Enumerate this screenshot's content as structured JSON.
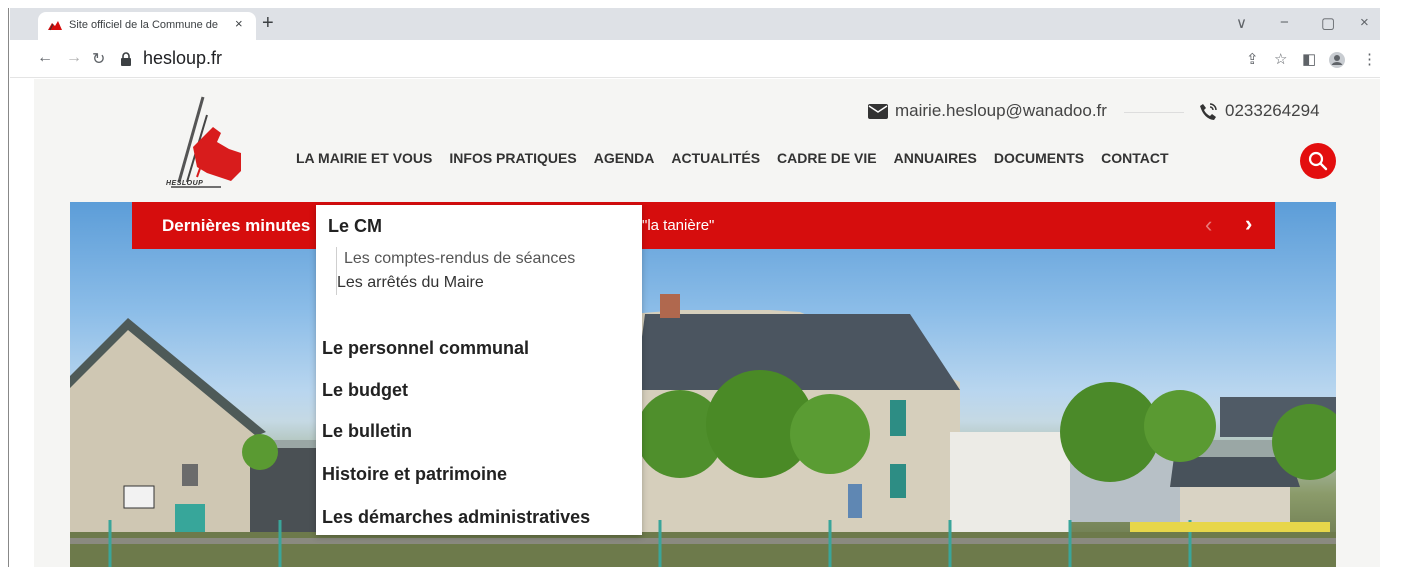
{
  "browser": {
    "tab_title": "Site officiel de la Commune de Hesloup",
    "tab_close": "×",
    "new_tab": "+",
    "url": "hesloup.fr",
    "window_controls": [
      "∨",
      "−",
      "▢",
      "×"
    ],
    "icons": [
      "back-icon",
      "forward-icon",
      "reload-icon",
      "lock-icon",
      "share-icon",
      "star-icon",
      "sidepanel-icon",
      "profile-icon",
      "menu-icon"
    ]
  },
  "site": {
    "logo_text": "HESLOUP",
    "email": "mairie.hesloup@wanadoo.fr",
    "phone": "0233264294",
    "menu": [
      "LA MAIRIE ET VOUS",
      "INFOS PRATIQUES",
      "AGENDA",
      "ACTUALITÉS",
      "CADRE DE VIE",
      "ANNUAIRES",
      "DOCUMENTS",
      "CONTACT"
    ],
    "news": {
      "label": "Dernières minutes",
      "headline": "\"la tanière\"",
      "prev": "‹",
      "next": "›"
    },
    "dropdown": {
      "header": "Le CM",
      "sub_items": [
        "Les comptes-rendus de séances",
        "Les arrêtés du Maire"
      ],
      "items": [
        "Le personnel communal",
        "Le budget",
        "Le bulletin",
        "Histoire et patrimoine",
        "Les démarches administratives"
      ]
    },
    "colors": {
      "accent": "#d60d0d",
      "search": "#e30e0e"
    }
  }
}
